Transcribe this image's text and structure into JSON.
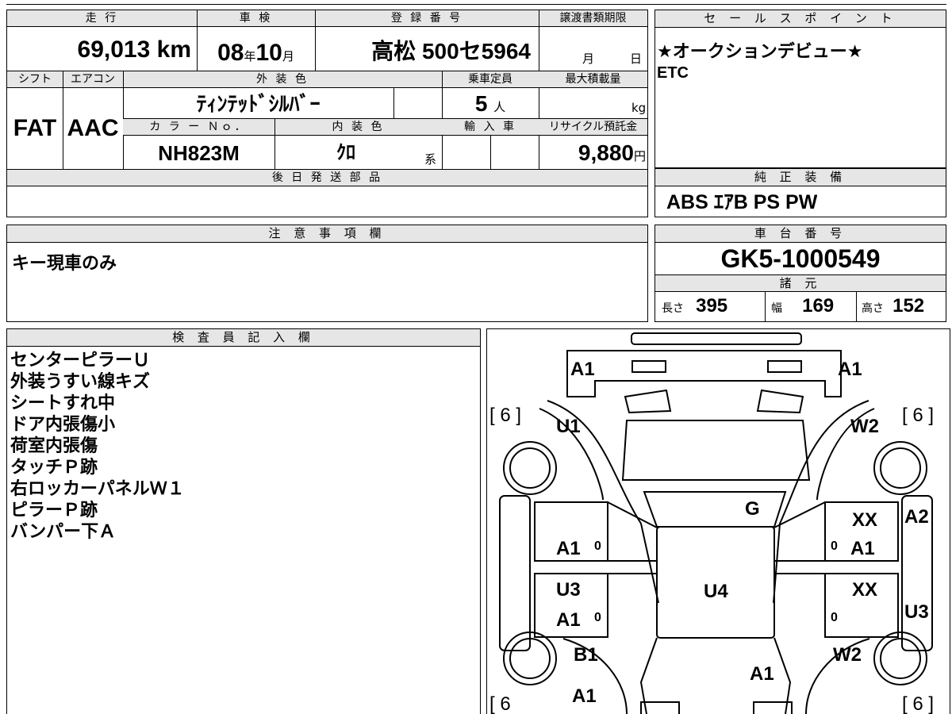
{
  "left_top": {
    "labels": {
      "mileage": "走 行",
      "inspection": "車 検",
      "registration": "登 録 番 号",
      "transfer": "譲渡書類期限",
      "shift": "シフト",
      "aircon": "エアコン",
      "exterior": "外 装 色",
      "capacity": "乗車定員",
      "max_load": "最大積載量",
      "color_no": "カ ラ ー Ｎｏ．",
      "interior": "内 装 色",
      "import": "輸 入 車",
      "recycle": "リサイクル預託金",
      "later_parts": "後 日 発 送 部 品"
    },
    "values": {
      "mileage": "69,013",
      "mileage_unit": "km",
      "inspection_year": "08",
      "year_unit": "年",
      "inspection_month": "10",
      "month_unit": "月",
      "registration": "高松 500セ5964",
      "transfer_month": "月",
      "transfer_day": "日",
      "shift": "FAT",
      "aircon": "AAC",
      "exterior": "ﾃｨﾝﾃｯﾄﾞｼﾙﾊﾞｰ",
      "capacity": "5",
      "capacity_unit": "人",
      "max_load_unit": "kg",
      "color_no": "NH823M",
      "interior": "ｸﾛ",
      "interior_unit": "系",
      "recycle": "9,880",
      "recycle_unit": "円"
    }
  },
  "sales_points": {
    "header": "セ ー ル ス ポ イ ン ト",
    "lines": [
      "★オークションデビュー★",
      "ETC"
    ]
  },
  "genuine_equipment": {
    "header": "純 正 装 備",
    "value": "ABS ｴｱB PS PW"
  },
  "notes": {
    "header": "注 意 事 項 欄",
    "value": "キー現車のみ"
  },
  "chassis": {
    "header": "車 台 番 号",
    "value": "GK5-1000549",
    "specs_header": "諸 元",
    "length_label": "長さ",
    "length": "395",
    "width_label": "幅",
    "width": "169",
    "height_label": "高さ",
    "height": "152"
  },
  "inspector": {
    "header": "検 査 員 記 入 欄",
    "lines": [
      "センターピラーＵ",
      "外装うすい線キズ",
      "シートすれ中",
      "ドア内張傷小",
      "荷室内張傷",
      "タッチＰ跡",
      "右ロッカーパネルＷ１",
      "ピラーＰ跡",
      "バンパー下Ａ"
    ]
  },
  "diagram": {
    "marks": {
      "rear_left": "A1",
      "rear_right": "A1",
      "tire_rl": "[ 6 ]",
      "tire_rr": "[ 6 ]",
      "tire_fl": "[ 6",
      "tire_fr": "[ 6 ]",
      "qp_left": "U1",
      "qp_right": "W2",
      "glass": "G",
      "rdoor_r_top": "XX",
      "rdoor_r_bottom": "A1",
      "side_right_top": "A2",
      "rdoor_l": "A1",
      "fdoor_l_top": "U3",
      "fdoor_l_bottom": "A1",
      "roof": "U4",
      "fdoor_r": "XX",
      "side_right_bottom": "U3",
      "fender_l": "B1",
      "fender_r": "W2",
      "hood": "A1",
      "front_l": "A1",
      "zero_1": "0",
      "zero_2": "0",
      "zero_3": "0",
      "zero_4": "0"
    }
  }
}
